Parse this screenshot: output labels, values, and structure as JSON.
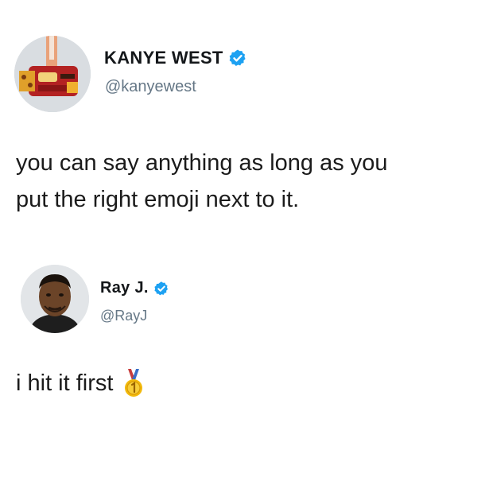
{
  "tweets": [
    {
      "display_name": "KANYE WEST",
      "handle": "@kanyewest",
      "verified": true,
      "text_lines": [
        "you can say anything as long as you",
        "put the right emoji next to it."
      ]
    },
    {
      "display_name": "Ray J.",
      "handle": "@RayJ",
      "verified": true,
      "text": "i hit it first",
      "emoji": "1st-place-medal-icon"
    }
  ],
  "colors": {
    "verified_blue": "#1da1f2",
    "handle_gray": "#657786",
    "text": "#14171a"
  }
}
